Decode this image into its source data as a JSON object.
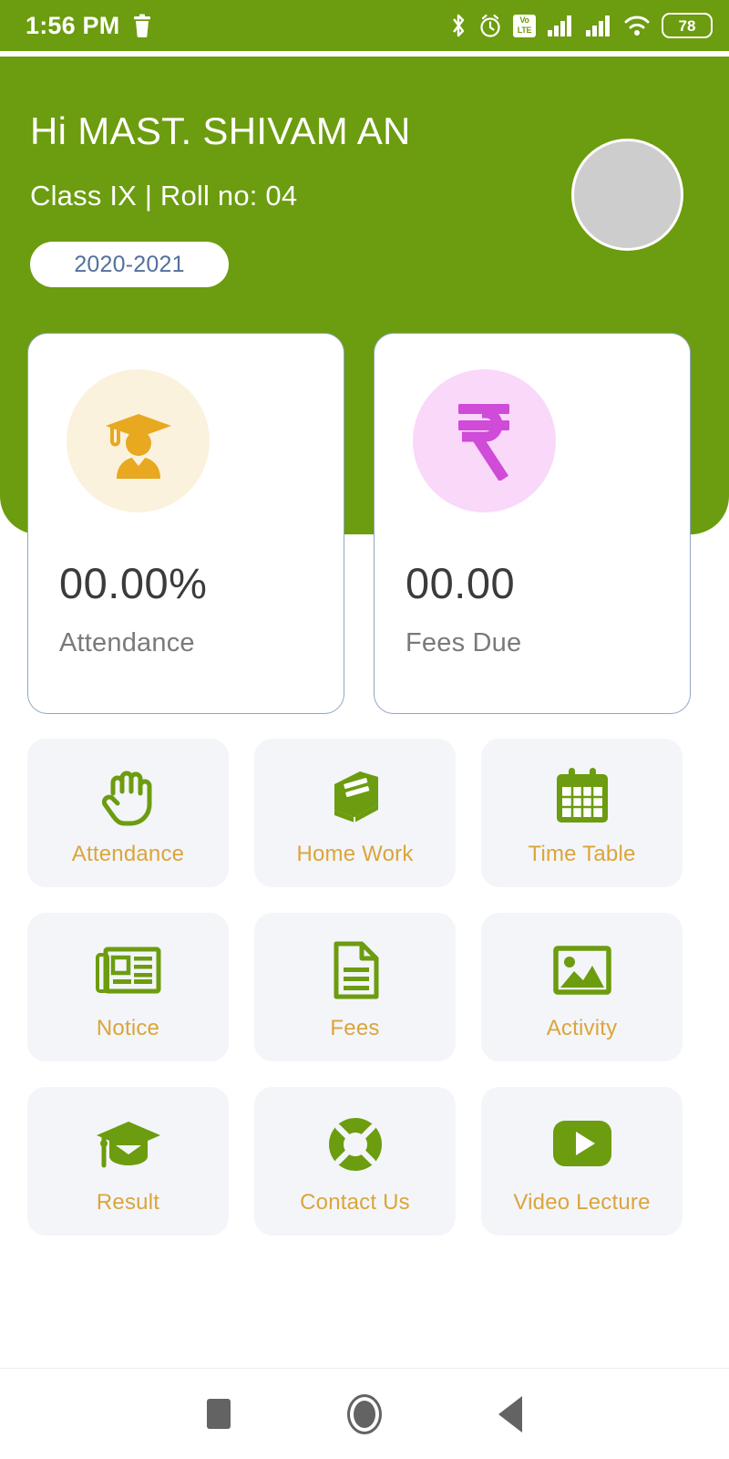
{
  "status_bar": {
    "time": "1:56 PM",
    "left_icons": [
      "trash-icon"
    ],
    "right_icons": [
      "bluetooth-icon",
      "alarm-icon",
      "volte-icon",
      "signal-bars-icon",
      "signal-bars-2-icon",
      "wifi-icon"
    ],
    "volte_top": "Vo",
    "volte_bottom": "LTE",
    "battery_level": "78",
    "background_color": "#6c9c0f"
  },
  "header": {
    "greeting": "Hi MAST. SHIVAM AN",
    "class_roll": "Class IX | Roll no: 04",
    "session": "2020-2021",
    "avatar_name": "avatar",
    "background_color": "#6c9c0f",
    "session_text_color": "#53709e"
  },
  "stats": [
    {
      "icon": "graduate-student-icon",
      "icon_color": "#e8a81f",
      "circle_color": "#fbf2dd",
      "value": "00.00%",
      "label": "Attendance"
    },
    {
      "icon": "rupee-icon",
      "icon_color": "#cf4bd8",
      "circle_color": "#f9d8f9",
      "value": "00.00",
      "label": "Fees Due"
    }
  ],
  "menu_tiles": [
    {
      "icon": "raised-hand-icon",
      "label": "Attendance"
    },
    {
      "icon": "book-icon",
      "label": "Home Work"
    },
    {
      "icon": "calendar-icon",
      "label": "Time Table"
    },
    {
      "icon": "newspaper-icon",
      "label": "Notice"
    },
    {
      "icon": "document-icon",
      "label": "Fees"
    },
    {
      "icon": "image-icon",
      "label": "Activity"
    },
    {
      "icon": "graduation-cap-icon",
      "label": "Result"
    },
    {
      "icon": "lifebuoy-icon",
      "label": "Contact Us"
    },
    {
      "icon": "play-button-icon",
      "label": "Video Lecture"
    }
  ],
  "tile_colors": {
    "background": "#f3f5f9",
    "icon": "#6c9c0f",
    "label": "#dba53a"
  },
  "nav_bar": {
    "recents_label": "recents-button",
    "home_label": "home-button",
    "back_label": "back-button"
  }
}
